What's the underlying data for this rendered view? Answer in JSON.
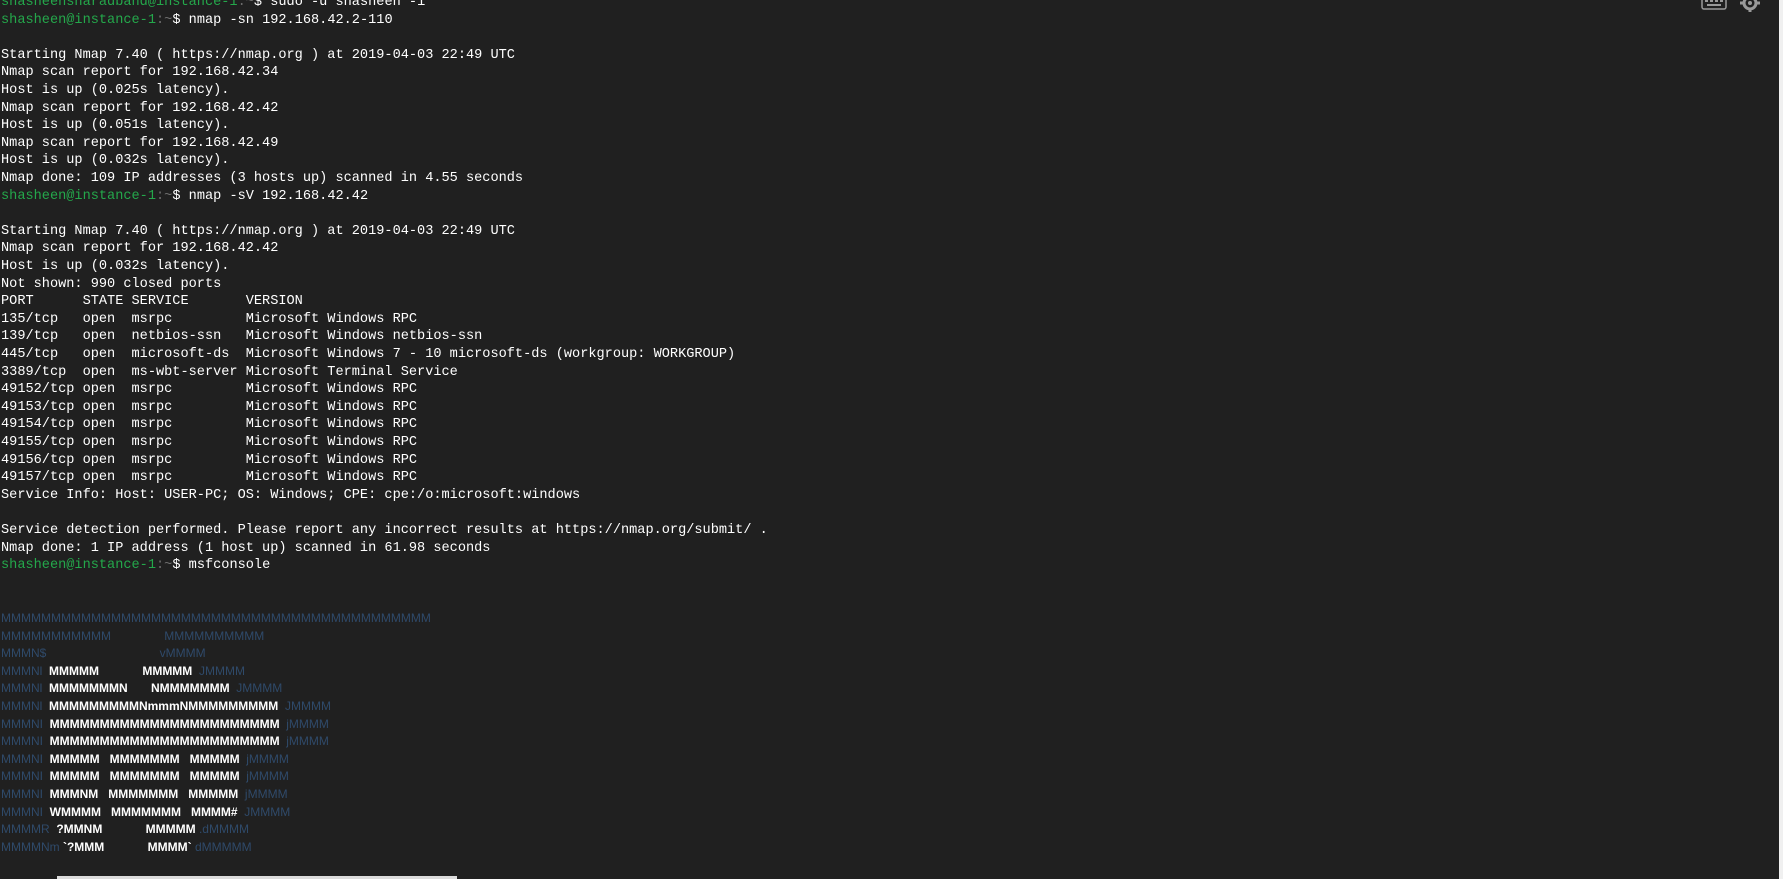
{
  "prompts": {
    "root_user": "shasheensharadband",
    "user": "shasheen",
    "host": "instance-1",
    "sep": ":~",
    "symbol": "$ "
  },
  "commands": {
    "sudo": "sudo -u shasheen -i",
    "nmap_sn": "nmap -sn 192.168.42.2-110",
    "nmap_sv": "nmap -sV 192.168.42.42",
    "msf": "msfconsole"
  },
  "output": {
    "scan1": [
      "",
      "Starting Nmap 7.40 ( https://nmap.org ) at 2019-04-03 22:49 UTC",
      "Nmap scan report for 192.168.42.34",
      "Host is up (0.025s latency).",
      "Nmap scan report for 192.168.42.42",
      "Host is up (0.051s latency).",
      "Nmap scan report for 192.168.42.49",
      "Host is up (0.032s latency).",
      "Nmap done: 109 IP addresses (3 hosts up) scanned in 4.55 seconds"
    ],
    "scan2": [
      "",
      "Starting Nmap 7.40 ( https://nmap.org ) at 2019-04-03 22:49 UTC",
      "Nmap scan report for 192.168.42.42",
      "Host is up (0.032s latency).",
      "Not shown: 990 closed ports",
      "PORT      STATE SERVICE       VERSION",
      "135/tcp   open  msrpc         Microsoft Windows RPC",
      "139/tcp   open  netbios-ssn   Microsoft Windows netbios-ssn",
      "445/tcp   open  microsoft-ds  Microsoft Windows 7 - 10 microsoft-ds (workgroup: WORKGROUP)",
      "3389/tcp  open  ms-wbt-server Microsoft Terminal Service",
      "49152/tcp open  msrpc         Microsoft Windows RPC",
      "49153/tcp open  msrpc         Microsoft Windows RPC",
      "49154/tcp open  msrpc         Microsoft Windows RPC",
      "49155/tcp open  msrpc         Microsoft Windows RPC",
      "49156/tcp open  msrpc         Microsoft Windows RPC",
      "49157/tcp open  msrpc         Microsoft Windows RPC",
      "Service Info: Host: USER-PC; OS: Windows; CPE: cpe:/o:microsoft:windows",
      "",
      "Service detection performed. Please report any incorrect results at https://nmap.org/submit/ .",
      "Nmap done: 1 IP address (1 host up) scanned in 61.98 seconds"
    ]
  },
  "banner": [
    [
      {
        "t": "MMMMMMMMMMMMMMMMMMMMMMMMMMMMMMMMMMMMMMMMMMM",
        "c": "dim"
      }
    ],
    [
      {
        "t": "MMMMMMMMMMM                MMMMMMMMMM",
        "c": "dim"
      }
    ],
    [
      {
        "t": "MMMN$                                  vMMMM",
        "c": "dim"
      }
    ],
    [
      {
        "t": "MMMNl  ",
        "c": "dim"
      },
      {
        "t": "MMMMM             MMMMM",
        "c": "bright"
      },
      {
        "t": "  JMMMM",
        "c": "dim"
      }
    ],
    [
      {
        "t": "MMMNl  ",
        "c": "dim"
      },
      {
        "t": "MMMMMMMN       NMMMMMMM",
        "c": "bright"
      },
      {
        "t": "  JMMMM",
        "c": "dim"
      }
    ],
    [
      {
        "t": "MMMNl  ",
        "c": "dim"
      },
      {
        "t": "MMMMMMMMMNmmmNMMMMMMMMM",
        "c": "bright"
      },
      {
        "t": "  JMMMM",
        "c": "dim"
      }
    ],
    [
      {
        "t": "MMMNI  ",
        "c": "dim"
      },
      {
        "t": "MMMMMMMMMMMMMMMMMMMMMMM",
        "c": "bright"
      },
      {
        "t": "  jMMMM",
        "c": "dim"
      }
    ],
    [
      {
        "t": "MMMNI  ",
        "c": "dim"
      },
      {
        "t": "MMMMMMMMMMMMMMMMMMMMMMM",
        "c": "bright"
      },
      {
        "t": "  jMMMM",
        "c": "dim"
      }
    ],
    [
      {
        "t": "MMMNI  ",
        "c": "dim"
      },
      {
        "t": "MMMMM   MMMMMMM   MMMMM",
        "c": "bright"
      },
      {
        "t": "  jMMMM",
        "c": "dim"
      }
    ],
    [
      {
        "t": "MMMNI  ",
        "c": "dim"
      },
      {
        "t": "MMMMM   MMMMMMM   MMMMM",
        "c": "bright"
      },
      {
        "t": "  jMMMM",
        "c": "dim"
      }
    ],
    [
      {
        "t": "MMMNI  ",
        "c": "dim"
      },
      {
        "t": "MMMNM   MMMMMMM   MMMMM",
        "c": "bright"
      },
      {
        "t": "  jMMMM",
        "c": "dim"
      }
    ],
    [
      {
        "t": "MMMNI  ",
        "c": "dim"
      },
      {
        "t": "WMMMM   MMMMMMM   MMMM#",
        "c": "bright"
      },
      {
        "t": "  JMMMM",
        "c": "dim"
      }
    ],
    [
      {
        "t": "MMMMR  ",
        "c": "dim"
      },
      {
        "t": "?MMNM             MMMMM",
        "c": "bright"
      },
      {
        "t": " .dMMMM",
        "c": "dim"
      }
    ],
    [
      {
        "t": "MMMMNm ",
        "c": "dim"
      },
      {
        "t": "`?MMM             MMMM`",
        "c": "bright"
      },
      {
        "t": " dMMMMM",
        "c": "dim"
      }
    ]
  ],
  "icons": {
    "keyboard": "keyboard-icon",
    "settings": "gear-icon"
  },
  "colors": {
    "background": "#202020",
    "prompt_green": "#24a84b",
    "text": "#ffffff",
    "logo_dim": "#2f4a6a"
  }
}
